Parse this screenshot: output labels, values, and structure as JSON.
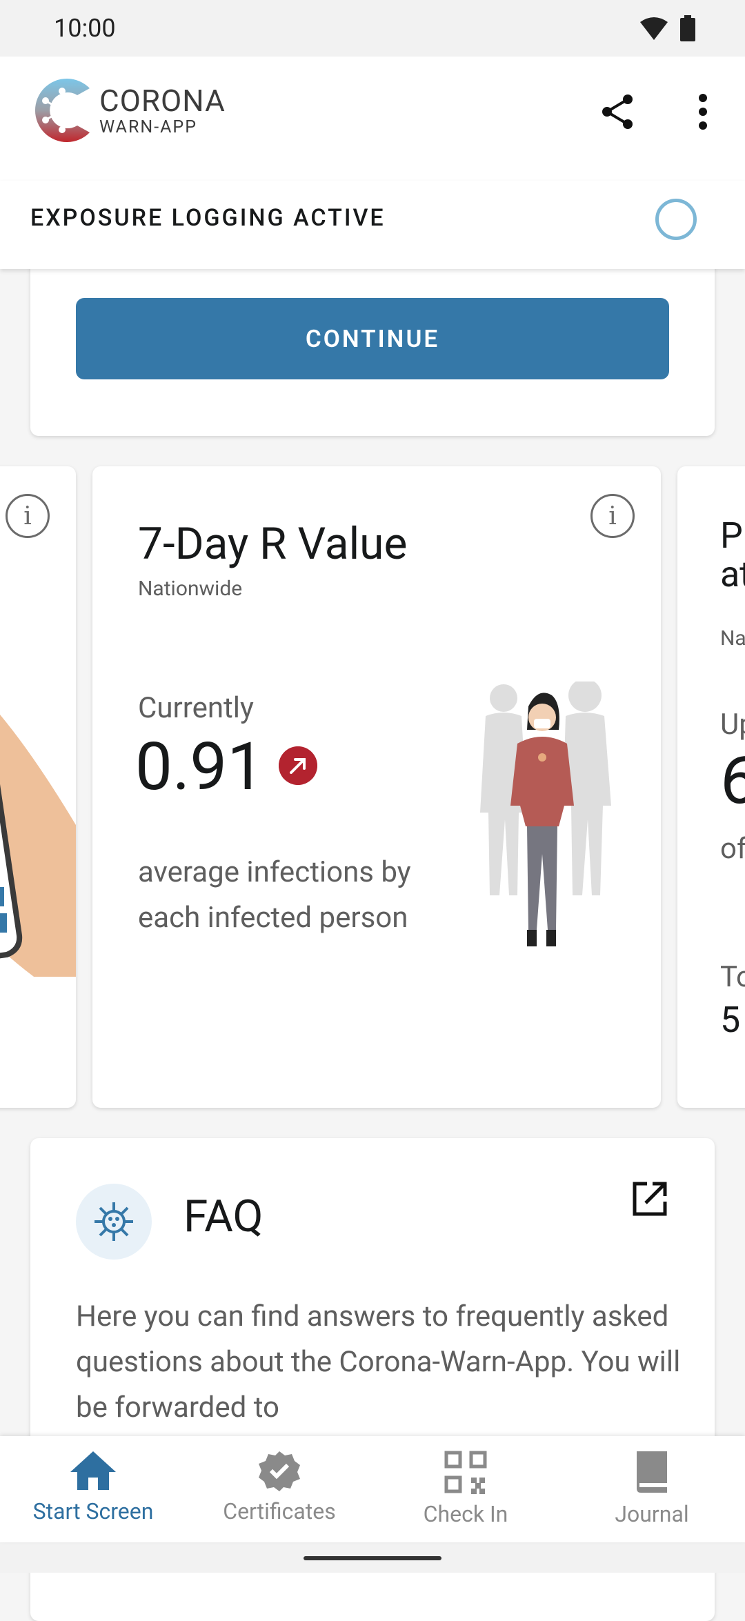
{
  "status_bar": {
    "time": "10:00"
  },
  "app": {
    "logo_line1": "CORONA",
    "logo_line2": "WARN-APP"
  },
  "tracing": {
    "label": "EXPOSURE LOGGING ACTIVE"
  },
  "card_top": {
    "button_label": "CONTINUE"
  },
  "stats_card": {
    "title": "7-Day R Value",
    "subtitle": "Nationwide",
    "currently_label": "Currently",
    "value": "0.91",
    "description": "average infections by each infected person"
  },
  "peek_card": {
    "line1": "P",
    "line2": "at",
    "line3": "Na",
    "line4": "Up",
    "line5": "6",
    "line6": "of",
    "line7": "To",
    "line8": "5"
  },
  "faq": {
    "title": "FAQ",
    "text": "Here you can find answers to frequently asked questions about the Corona-Warn-App. You will be forwarded to"
  },
  "bottom_nav": [
    {
      "label": "Start Screen",
      "icon": "home-icon",
      "active": true
    },
    {
      "label": "Certificates",
      "icon": "certificate-badge-icon",
      "active": false
    },
    {
      "label": "Check In",
      "icon": "qr-code-icon",
      "active": false
    },
    {
      "label": "Journal",
      "icon": "book-icon",
      "active": false
    }
  ],
  "colors": {
    "primary": "#3578a8",
    "trend_red": "#b3232f",
    "nav_active": "#2e6fa0"
  }
}
